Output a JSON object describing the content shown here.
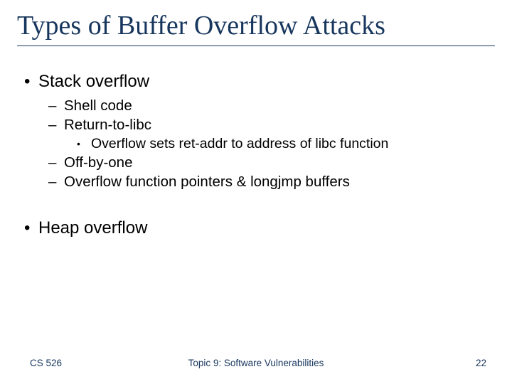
{
  "title": "Types of Buffer Overflow Attacks",
  "bullets": {
    "b1": "Stack overflow",
    "b1a": "Shell code",
    "b1b": "Return-to-libc",
    "b1b1": "Overflow sets ret-addr to address of libc function",
    "b1c": "Off-by-one",
    "b1d": "Overflow function pointers & longjmp buffers",
    "b2": "Heap overflow"
  },
  "footer": {
    "left": "CS 526",
    "center": "Topic 9: Software Vulnerabilities",
    "right": "22"
  }
}
